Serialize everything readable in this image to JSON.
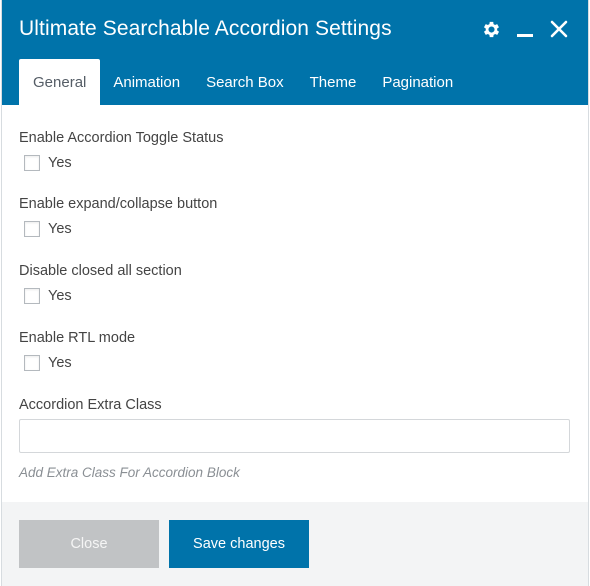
{
  "dialog": {
    "title": "Ultimate Searchable Accordion Settings",
    "icons": [
      "gear-icon",
      "minimize-icon",
      "close-icon"
    ]
  },
  "tabs": [
    {
      "label": "General",
      "active": true
    },
    {
      "label": "Animation",
      "active": false
    },
    {
      "label": "Search Box",
      "active": false
    },
    {
      "label": "Theme",
      "active": false
    },
    {
      "label": "Pagination",
      "active": false
    }
  ],
  "fields": {
    "toggle_status": {
      "label": "Enable Accordion Toggle Status",
      "option": "Yes",
      "checked": false
    },
    "expand_collapse": {
      "label": "Enable expand/collapse button",
      "option": "Yes",
      "checked": false
    },
    "disable_closed": {
      "label": "Disable closed all section",
      "option": "Yes",
      "checked": false
    },
    "rtl_mode": {
      "label": "Enable RTL mode",
      "option": "Yes",
      "checked": false
    },
    "extra_class": {
      "label": "Accordion Extra Class",
      "value": "",
      "hint": "Add Extra Class For Accordion Block"
    }
  },
  "footer": {
    "close_label": "Close",
    "save_label": "Save changes"
  },
  "colors": {
    "header": "#0073aa",
    "primary_button": "#0073aa",
    "disabled_button": "#c1c3c5",
    "footer_bg": "#f3f4f5"
  }
}
